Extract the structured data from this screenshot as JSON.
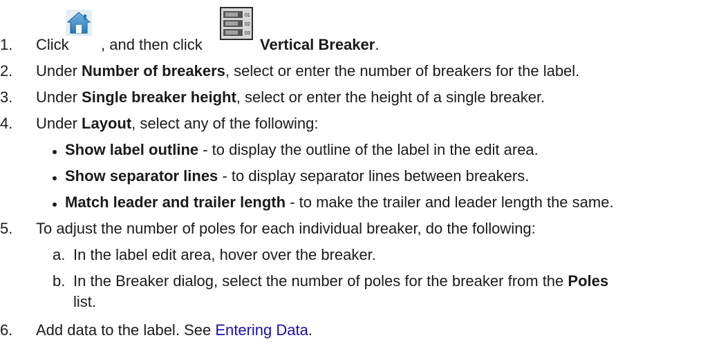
{
  "steps": [
    {
      "num": "1.",
      "pre": "Click ",
      "mid": ", and then click ",
      "bold": "Vertical Breaker",
      "post": "."
    },
    {
      "num": "2.",
      "pre": "Under ",
      "bold": "Number of breakers",
      "post": ", select or enter the number of breakers for the label."
    },
    {
      "num": "3.",
      "pre": "Under ",
      "bold": "Single breaker height",
      "post": ", select or enter the height of a single breaker."
    },
    {
      "num": "4.",
      "pre": "Under ",
      "bold": "Layout",
      "post": ", select any of the following:"
    },
    {
      "num": "5.",
      "text": "To adjust the number of poles for each individual breaker, do the following:"
    },
    {
      "num": "6.",
      "pre": "Add data to the label. See ",
      "link": "Entering Data",
      "post": "."
    }
  ],
  "bullets": [
    {
      "bold": "Show label outline",
      "post": " - to display the outline of the label in the edit area."
    },
    {
      "bold": "Show separator lines",
      "post": " - to display separator lines between breakers."
    },
    {
      "bold": "Match leader and trailer length",
      "post": " - to make the trailer and leader length the same."
    }
  ],
  "substeps": [
    {
      "letter": "a.",
      "text": "In the label edit area, hover over the breaker."
    },
    {
      "letter": "b.",
      "pre": "In the Breaker dialog, select the number of poles for the breaker from the ",
      "bold": "Poles",
      "cont": "list."
    }
  ],
  "icons": {
    "home": "home-icon",
    "breaker": "vertical-breaker-icon",
    "breaker_labels": [
      "01",
      "02",
      "03"
    ]
  }
}
